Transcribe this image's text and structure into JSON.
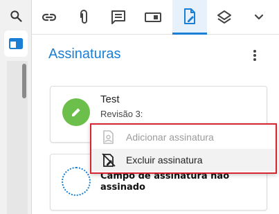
{
  "panel": {
    "title": "Assinaturas"
  },
  "signatures": [
    {
      "name": "Test",
      "revision": "Revisão 3:"
    }
  ],
  "unsigned_field": {
    "text": "Campo de assinatura não assinado"
  },
  "context_menu": {
    "items": [
      {
        "label": "Adicionar assinatura",
        "enabled": false
      },
      {
        "label": "Excluir assinatura",
        "enabled": true
      }
    ]
  },
  "colors": {
    "accent": "#1a7fd4",
    "signed_green": "#6cbf4a",
    "highlight_red": "#d6252f"
  },
  "toolbar_icons": [
    "link-icon",
    "paperclip-icon",
    "comment-icon",
    "form-field-icon",
    "signature-icon",
    "layers-icon",
    "chevron-down-icon"
  ]
}
